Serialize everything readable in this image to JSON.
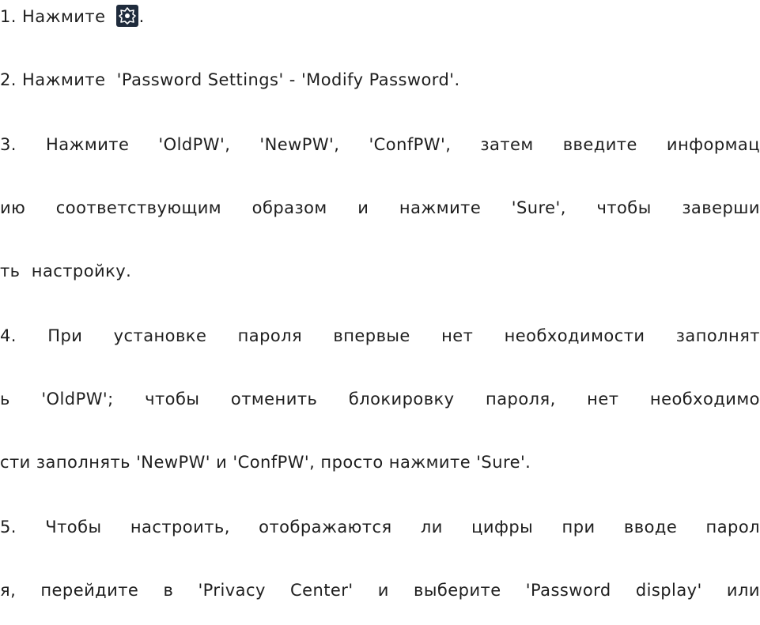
{
  "steps": [
    {
      "id": "step-1",
      "lines": [
        {
          "before": "1. Нажмите ",
          "icon": "gear-icon",
          "after": "."
        }
      ]
    },
    {
      "id": "step-2",
      "lines": [
        {
          "text": "2. Нажмите  'Password Settings' - 'Modify Password'."
        }
      ]
    },
    {
      "id": "step-3",
      "lines": [
        {
          "text": "3. Нажмите 'OldPW', 'NewPW', 'ConfPW', затем введите информац"
        },
        {
          "text": "ию соответствующим образом и нажмите 'Sure', чтобы заверши"
        },
        {
          "text": "ть  настройку."
        }
      ]
    },
    {
      "id": "step-4",
      "lines": [
        {
          "text": "4. При установке пароля впервые нет необходимости заполнят"
        },
        {
          "text": "ь 'OldPW'; чтобы отменить блокировку пароля, нет необходимо"
        },
        {
          "text": "сти заполнять 'NewPW' и 'ConfPW', просто нажмите 'Sure'."
        }
      ]
    },
    {
      "id": "step-5",
      "lines": [
        {
          "text": "5. Чтобы настроить, отображаются ли цифры при вводе парол"
        },
        {
          "text": "я, перейдите в 'Privacy Center' и выберите 'Password display' или"
        }
      ]
    }
  ],
  "colors": {
    "text": "#1e1e1e",
    "icon_bg": "#1f2b3c",
    "icon_fg": "#ffffff"
  }
}
